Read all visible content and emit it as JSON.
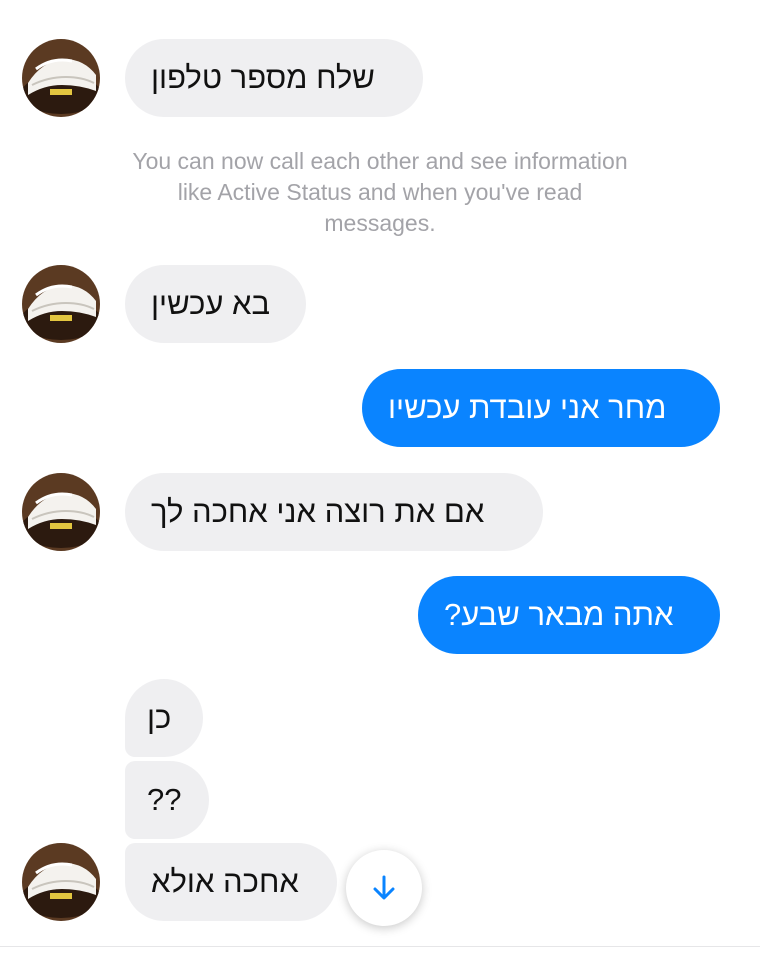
{
  "conversation": {
    "messages": [
      {
        "sender": "contact",
        "text": "שלח מספר טלפון",
        "show_avatar": true
      },
      {
        "sender": "contact",
        "text": "בא עכשין",
        "show_avatar": true
      },
      {
        "sender": "me",
        "text": "מחר אני עובדת עכשיו"
      },
      {
        "sender": "contact",
        "text": "אם את רוצה אני אחכה לך",
        "show_avatar": true
      },
      {
        "sender": "me",
        "text": "אתה מבאר שבע?"
      },
      {
        "sender": "contact",
        "text": "כן",
        "show_avatar": false
      },
      {
        "sender": "contact",
        "text": "??",
        "show_avatar": false
      },
      {
        "sender": "contact",
        "text": "אחכה אולא",
        "show_avatar": true
      }
    ],
    "system_note": "You can now call each other and see information like Active Status and when you've read messages."
  },
  "controls": {
    "scroll_down_icon": "arrow-down-icon"
  },
  "colors": {
    "outgoing_bubble": "#0a84ff",
    "incoming_bubble": "#efeff1",
    "system_text": "#a3a3a8",
    "accent": "#0a84ff"
  }
}
